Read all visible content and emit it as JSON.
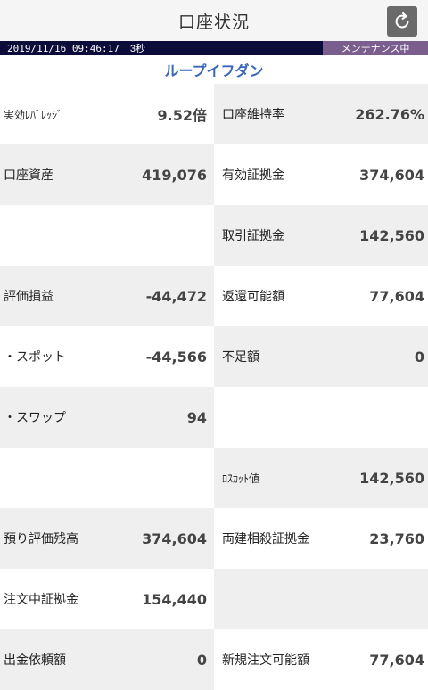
{
  "header": {
    "title": "口座状況",
    "refresh_icon": "refresh-icon"
  },
  "status": {
    "timestamp": "2019/11/16 09:46:17",
    "interval": "3秒",
    "maintenance": "メンテナンス中"
  },
  "account": {
    "name": "ループイフダン"
  },
  "rows": [
    {
      "left": {
        "label": "実効ﾚﾊﾞﾚｯｼﾞ",
        "value": "9.52倍"
      },
      "right": {
        "label": "口座維持率",
        "value": "262.76%"
      }
    },
    {
      "left": {
        "label": "口座資産",
        "value": "419,076"
      },
      "right": {
        "label": "有効証拠金",
        "value": "374,604"
      }
    },
    {
      "left": {
        "label": "",
        "value": ""
      },
      "right": {
        "label": "取引証拠金",
        "value": "142,560"
      }
    },
    {
      "left": {
        "label": "評価損益",
        "value": "-44,472"
      },
      "right": {
        "label": "返還可能額",
        "value": "77,604"
      }
    },
    {
      "left": {
        "label": "・スポット",
        "value": "-44,566"
      },
      "right": {
        "label": "不足額",
        "value": "0"
      }
    },
    {
      "left": {
        "label": "・スワップ",
        "value": "94"
      },
      "right": {
        "label": "",
        "value": ""
      }
    },
    {
      "left": {
        "label": "",
        "value": ""
      },
      "right": {
        "label": "ﾛｽｶｯﾄ値",
        "value": "142,560"
      }
    },
    {
      "left": {
        "label": "預り評価残高",
        "value": "374,604"
      },
      "right": {
        "label": "両建相殺証拠金",
        "value": "23,760"
      }
    },
    {
      "left": {
        "label": "注文中証拠金",
        "value": "154,440"
      },
      "right": {
        "label": "",
        "value": ""
      }
    },
    {
      "left": {
        "label": "出金依頼額",
        "value": "0"
      },
      "right": {
        "label": "新規注文可能額",
        "value": "77,604"
      }
    }
  ]
}
